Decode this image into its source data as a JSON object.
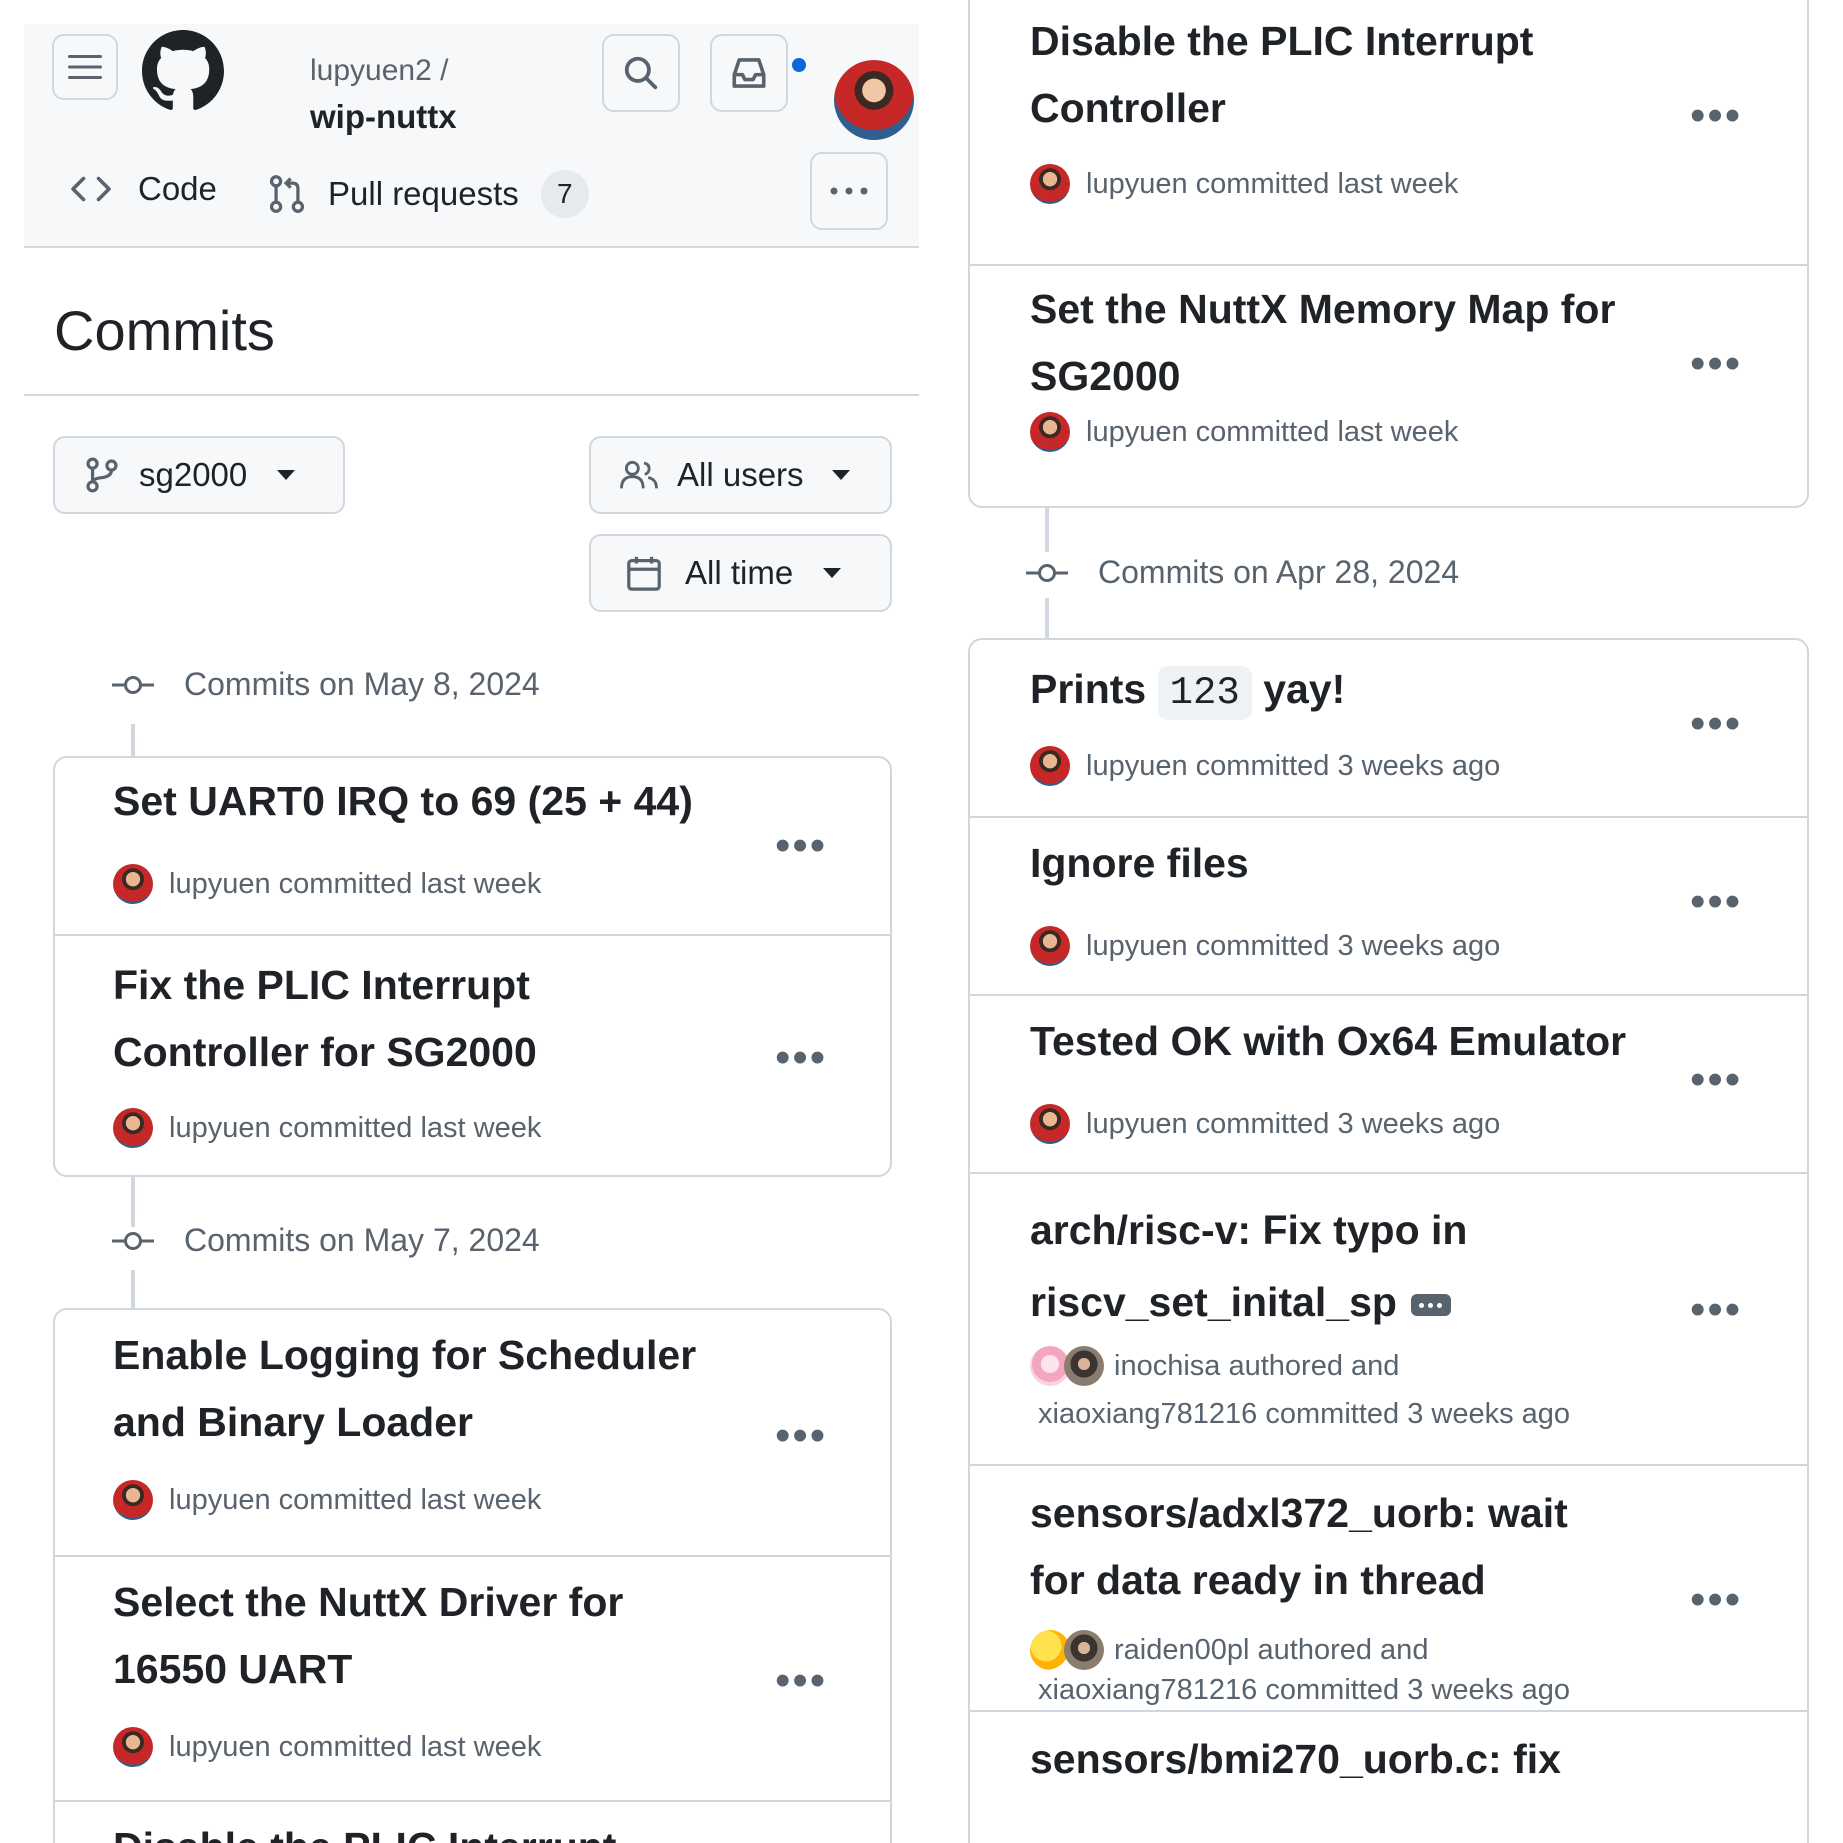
{
  "header": {
    "repo_owner": "lupyuen2 /",
    "repo_name": "wip-nuttx",
    "nav": [
      {
        "label": "Code",
        "icon": "code-icon"
      },
      {
        "label": "Pull requests",
        "icon": "git-pull-request-icon",
        "counter": "7"
      }
    ]
  },
  "page_title": "Commits",
  "filters": {
    "branch": "sg2000",
    "users": "All users",
    "time": "All time"
  },
  "left_groups": [
    {
      "date_label": "Commits on May 8, 2024",
      "commits": [
        {
          "title": "Set UART0 IRQ to 69 (25 + 44)",
          "author": "lupyuen",
          "meta": "committed last week"
        },
        {
          "title_line1": "Fix the PLIC Interrupt",
          "title_line2": "Controller for SG2000",
          "author": "lupyuen",
          "meta": "committed last week"
        }
      ]
    },
    {
      "date_label": "Commits on May 7, 2024",
      "commits": [
        {
          "title_line1": "Enable Logging for Scheduler",
          "title_line2": "and Binary Loader",
          "author": "lupyuen",
          "meta": "committed last week"
        },
        {
          "title_line1": "Select the NuttX Driver for",
          "title_line2": "16550 UART",
          "author": "lupyuen",
          "meta": "committed last week"
        },
        {
          "title_partial": "Disable the PLIC Interrupt"
        }
      ]
    }
  ],
  "right_top_commits": [
    {
      "title_line1": "Disable the PLIC Interrupt",
      "title_line2": "Controller",
      "author": "lupyuen",
      "meta": "committed last week"
    },
    {
      "title_line1": "Set the NuttX Memory Map for",
      "title_line2": "SG2000",
      "author": "lupyuen",
      "meta": "committed last week"
    }
  ],
  "right_group": {
    "date_label": "Commits on Apr 28, 2024",
    "commits": [
      {
        "title_pre": "Prints",
        "title_code": "123",
        "title_post": "yay!",
        "author": "lupyuen",
        "meta": "committed 3 weeks ago"
      },
      {
        "title": "Ignore files",
        "author": "lupyuen",
        "meta": "committed 3 weeks ago"
      },
      {
        "title": "Tested OK with Ox64 Emulator",
        "author": "lupyuen",
        "meta": "committed 3 weeks ago"
      },
      {
        "title_line1": "arch/risc-v: Fix typo in",
        "title_line2": "riscv_set_inital_sp",
        "author": "inochisa",
        "meta": "authored and",
        "committer": "xiaoxiang781216",
        "meta2": "committed 3 weeks ago"
      },
      {
        "title_line1": "sensors/adxl372_uorb: wait",
        "title_line2": "for data ready in thread",
        "author": "raiden00pl",
        "meta": "authored and",
        "committer": "xiaoxiang781216",
        "meta2": "committed 3 weeks ago"
      },
      {
        "title_partial": "sensors/bmi270_uorb.c: fix"
      }
    ]
  },
  "colors": {
    "accent_blue": "#0969da",
    "border": "#d0d7de",
    "muted_text": "#59636e",
    "header_bg": "#f6f8fa"
  }
}
